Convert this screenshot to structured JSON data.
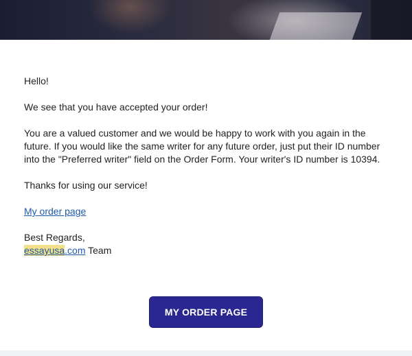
{
  "greeting": "Hello!",
  "accepted": "We see that you have accepted your order!",
  "valued_customer": "You are a valued customer and we would be happy to work with you again in the future. If you would like the same writer for any future order, just put their ID number into the \"Preferred writer\" field on the Order Form. Your writer's ID number is 10394.",
  "thanks": "Thanks for using our service!",
  "order_link": "My order page",
  "regards": "Best Regards,",
  "brand_highlight": "essayusa",
  "brand_rest": ".com",
  "team": " Team",
  "cta_label": "MY ORDER PAGE"
}
